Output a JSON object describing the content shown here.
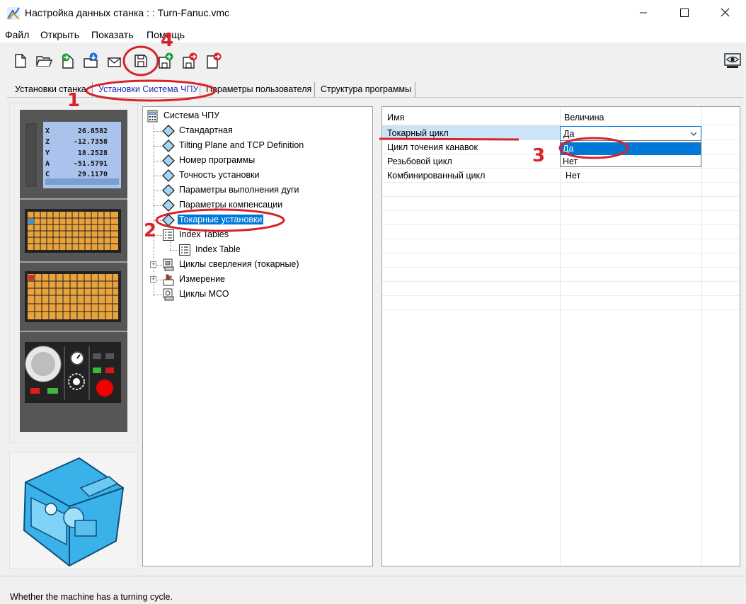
{
  "window": {
    "title": "Настройка данных станка : : Turn-Fanuc.vmc"
  },
  "menu": [
    "Файл",
    "Открыть",
    "Показать",
    "Помощь"
  ],
  "toolbar": {
    "buttons": [
      "new-file-icon",
      "open-folder-icon",
      "import-icon",
      "download-icon",
      "mail-icon",
      "save-icon",
      "save-add-icon",
      "save-export-icon",
      "export-icon"
    ],
    "right_button": "preview-icon"
  },
  "tabs": [
    "Установки станка",
    "Установки Система ЧПУ",
    "Параметры пользователя",
    "Структура программы"
  ],
  "cnc_display": {
    "rows": [
      {
        "axis": "X",
        "value": "26.8582"
      },
      {
        "axis": "Z",
        "value": "-12.7358"
      },
      {
        "axis": "Y",
        "value": "18.2528"
      },
      {
        "axis": "A",
        "value": "-51.5791"
      },
      {
        "axis": "C",
        "value": "29.1170"
      }
    ]
  },
  "tree": {
    "root": "Система ЧПУ",
    "items": [
      "Стандартная",
      "Tilting Plane and TCP Definition",
      "Номер программы",
      "Точность установки",
      "Параметры выполнения дуги",
      "Параметры компенсации",
      "Токарные установки",
      "Index Tables",
      "Index Table",
      "Циклы сверления (токарные)",
      "Измерение",
      "Циклы МСО"
    ]
  },
  "grid": {
    "headers": [
      "Имя",
      "Величина"
    ],
    "rows": [
      {
        "name": "Токарный цикл",
        "value": "Да"
      },
      {
        "name": "Цикл точения канавок",
        "value": ""
      },
      {
        "name": "Резьбовой цикл",
        "value": ""
      },
      {
        "name": "Комбинированный цикл",
        "value": "Нет"
      }
    ],
    "dropdown_options": [
      "Да",
      "Нет"
    ]
  },
  "status": "Whether the machine has a turning cycle.",
  "annotations": [
    "1",
    "2",
    "3",
    "4"
  ],
  "colors": {
    "accent": "#0078d7",
    "annotation": "#d8232a",
    "active_tab_text": "#1a2bb8",
    "selection_light": "#cce4f7"
  }
}
